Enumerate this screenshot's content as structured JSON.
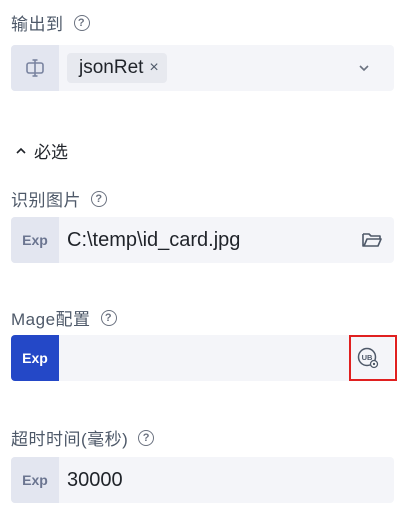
{
  "output": {
    "label": "输出到",
    "help": "?",
    "tag_value": "jsonRet",
    "tag_close": "×"
  },
  "required_section": {
    "toggle_glyph": "^",
    "label": "必选"
  },
  "recognize_image": {
    "label": "识别图片",
    "help": "?",
    "prefix": "Exp",
    "value": "C:\\temp\\id_card.jpg"
  },
  "mage_config": {
    "label": "Mage配置",
    "help": "?",
    "prefix": "Exp",
    "value": ""
  },
  "timeout": {
    "label": "超时时间(毫秒)",
    "help": "?",
    "prefix": "Exp",
    "value": "30000"
  }
}
